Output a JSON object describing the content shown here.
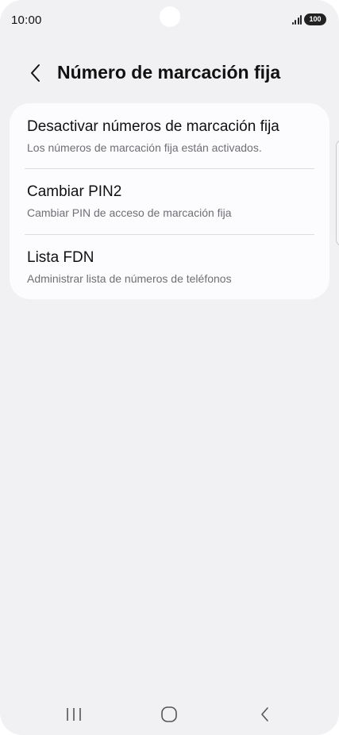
{
  "status_bar": {
    "time": "10:00",
    "battery": "100",
    "signal_icon": "signal-icon",
    "battery_icon": "battery-icon"
  },
  "header": {
    "back_icon": "chevron-left-icon",
    "title": "Número de marcación fija"
  },
  "settings": {
    "items": [
      {
        "title": "Desactivar números de marcación fija",
        "subtitle": "Los números de marcación fija están activados."
      },
      {
        "title": "Cambiar PIN2",
        "subtitle": "Cambiar PIN de acceso de marcación fija"
      },
      {
        "title": "Lista FDN",
        "subtitle": "Administrar lista de números de teléfonos"
      }
    ]
  },
  "nav_bar": {
    "recents_icon": "recent-apps-icon",
    "home_icon": "home-icon",
    "back_icon": "back-icon"
  },
  "colors": {
    "background": "#f1f1f4",
    "card": "#fcfcfe",
    "text_primary": "#111111",
    "text_secondary": "#6f6f74",
    "divider": "#dedee2"
  }
}
